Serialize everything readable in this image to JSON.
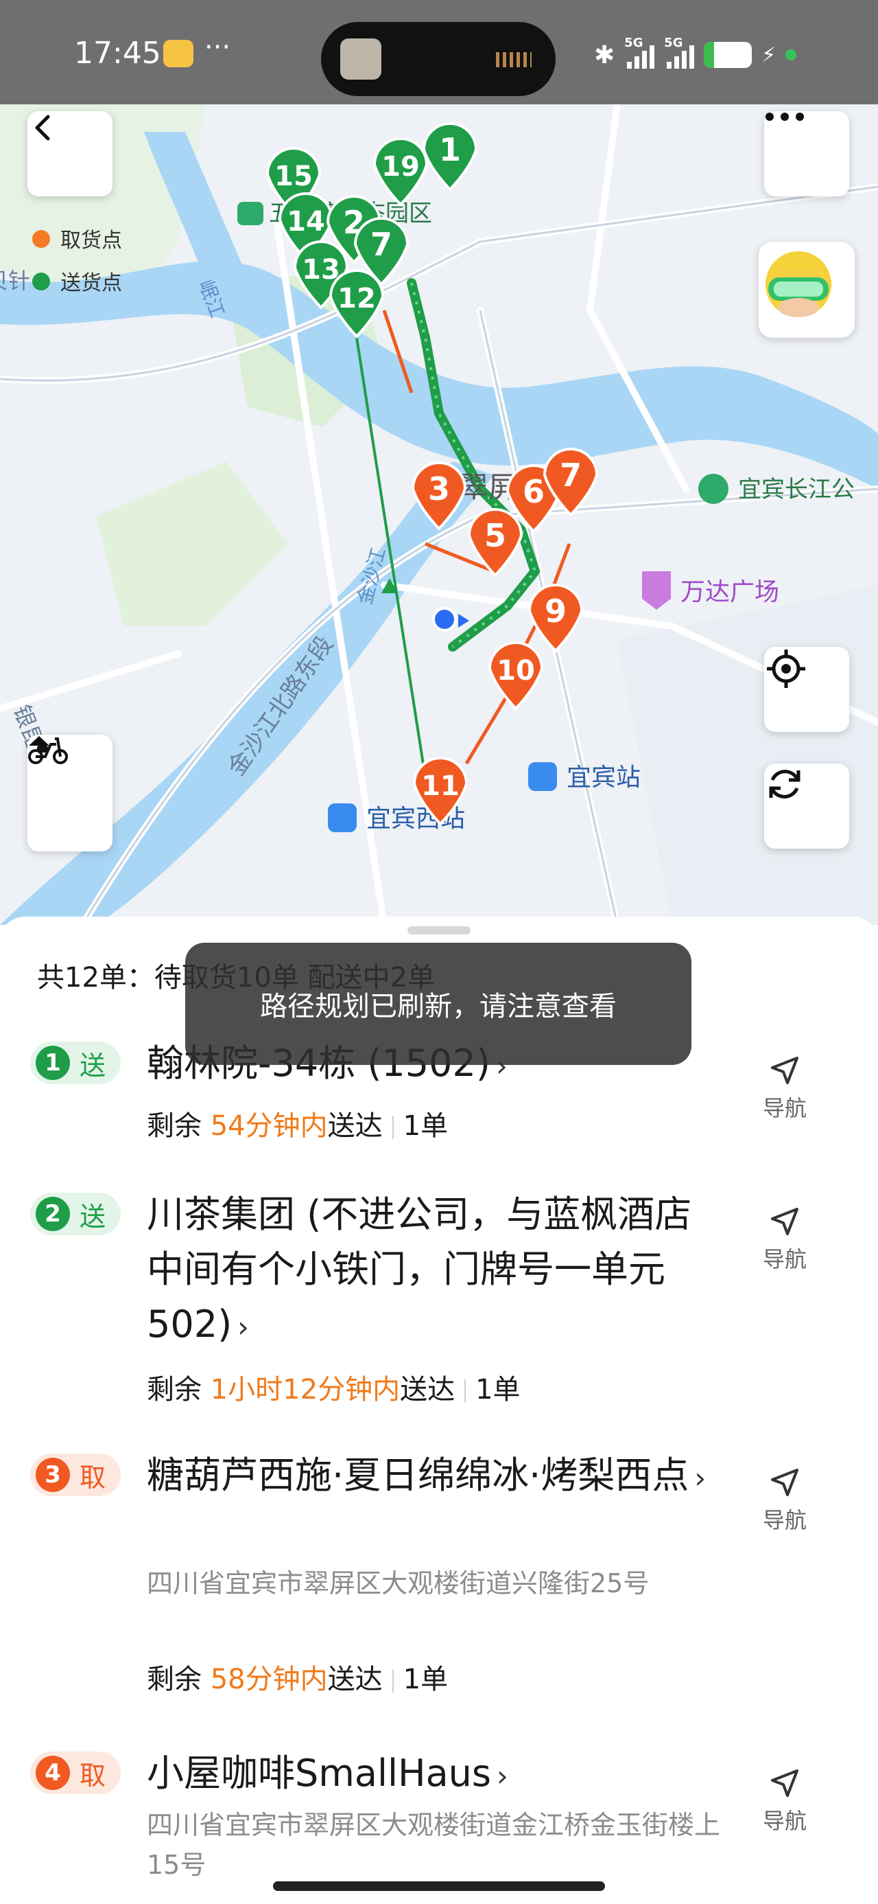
{
  "status": {
    "time": "17:45",
    "more": "···",
    "net1": "5G",
    "net2": "5G",
    "battery": "21",
    "battery_level": 0.21
  },
  "map": {
    "legend": {
      "pickup": "取货点",
      "delivery": "送货点"
    },
    "places": {
      "park": "五粮液生态园区",
      "district": "翠屏区",
      "river_east": "宜宾长江公",
      "mall": "万达广场",
      "station": "宜宾站",
      "west_station": "宜宾西站",
      "road": "金沙江北路东段",
      "river_jinsha": "金沙江",
      "river_min": "岷江",
      "edge_left": "银昆高",
      "edge_top_left": "贝针"
    },
    "pins_green": [
      "1",
      "19",
      "15",
      "14",
      "2",
      "7",
      "13",
      "12"
    ],
    "pins_orange": [
      "3",
      "6",
      "7",
      "5",
      "9",
      "10",
      "11"
    ],
    "icons": {
      "back": "back-arrow-icon",
      "more": "more-dots-icon",
      "avatar": "rider-avatar-icon",
      "locate": "locate-icon",
      "refresh": "refresh-route-icon",
      "scooter": "scooter-icon"
    }
  },
  "sheet": {
    "summary": "共12单：待取货10单 配送中2单",
    "toast": "路径规划已刷新，请注意查看",
    "nav_label": "导航",
    "orders": [
      {
        "num": "1",
        "type": "送",
        "title": "翰林院-34栋 (1502)",
        "address": "",
        "meta_prefix": "剩余 ",
        "meta_highlight": "54分钟内",
        "meta_suffix": "送达",
        "count": "1单",
        "color": "green"
      },
      {
        "num": "2",
        "type": "送",
        "title": "川茶集团 (不进公司，与蓝枫酒店中间有个小铁门，门牌号一单元502)",
        "address": "",
        "meta_prefix": "剩余 ",
        "meta_highlight": "1小时12分钟内",
        "meta_suffix": "送达",
        "count": "1单",
        "color": "green"
      },
      {
        "num": "3",
        "type": "取",
        "title": "糖葫芦西施·夏日绵绵冰·烤梨西点",
        "address": "四川省宜宾市翠屏区大观楼街道兴隆街25号",
        "meta_prefix": "剩余 ",
        "meta_highlight": "58分钟内",
        "meta_suffix": "送达",
        "count": "1单",
        "color": "orange"
      },
      {
        "num": "4",
        "type": "取",
        "title": "小屋咖啡SmallHaus",
        "address": "四川省宜宾市翠屏区大观楼街道金江桥金玉街楼上15号",
        "meta_prefix": "",
        "meta_highlight": "",
        "meta_suffix": "",
        "count": "",
        "color": "orange"
      }
    ]
  }
}
